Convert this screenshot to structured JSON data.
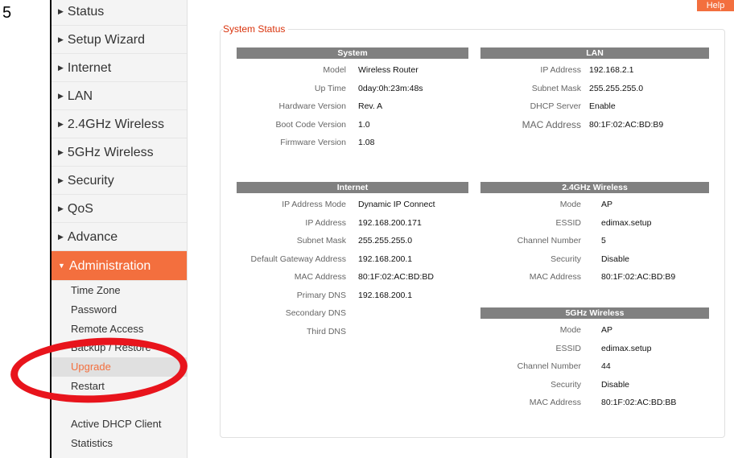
{
  "step_number": "5",
  "help_label": "Help",
  "sidebar": {
    "items": [
      {
        "label": "Status"
      },
      {
        "label": "Setup Wizard"
      },
      {
        "label": "Internet"
      },
      {
        "label": "LAN"
      },
      {
        "label": "2.4GHz Wireless"
      },
      {
        "label": "5GHz Wireless"
      },
      {
        "label": "Security"
      },
      {
        "label": "QoS"
      },
      {
        "label": "Advance"
      },
      {
        "label": "Administration"
      }
    ],
    "admin_subitems": [
      {
        "label": "Time Zone"
      },
      {
        "label": "Password"
      },
      {
        "label": "Remote Access"
      },
      {
        "label": "Backup / Restore"
      },
      {
        "label": "Upgrade"
      },
      {
        "label": "Restart"
      },
      {
        "label": "Active DHCP Client"
      },
      {
        "label": "Statistics"
      }
    ]
  },
  "panel_title": "System Status",
  "system": {
    "header": "System",
    "rows": [
      {
        "label": "Model",
        "value": "Wireless Router"
      },
      {
        "label": "Up Time",
        "value": "0day:0h:23m:48s"
      },
      {
        "label": "Hardware Version",
        "value": "Rev. A"
      },
      {
        "label": "Boot Code Version",
        "value": "1.0"
      },
      {
        "label": "Firmware Version",
        "value": "1.08"
      }
    ]
  },
  "lan": {
    "header": "LAN",
    "rows": [
      {
        "label": "IP Address",
        "value": "192.168.2.1"
      },
      {
        "label": "Subnet Mask",
        "value": "255.255.255.0"
      },
      {
        "label": "DHCP Server",
        "value": "Enable"
      },
      {
        "label": "MAC Address",
        "value": "80:1F:02:AC:BD:B9"
      }
    ]
  },
  "internet": {
    "header": "Internet",
    "rows": [
      {
        "label": "IP Address Mode",
        "value": "Dynamic IP  Connect"
      },
      {
        "label": "IP Address",
        "value": "192.168.200.171"
      },
      {
        "label": "Subnet Mask",
        "value": "255.255.255.0"
      },
      {
        "label": "Default Gateway Address",
        "value": "192.168.200.1"
      },
      {
        "label": "MAC Address",
        "value": "80:1F:02:AC:BD:BD"
      },
      {
        "label": "Primary DNS",
        "value": "192.168.200.1"
      },
      {
        "label": "Secondary DNS",
        "value": ""
      },
      {
        "label": "Third DNS",
        "value": ""
      }
    ]
  },
  "wireless24": {
    "header": "2.4GHz  Wireless",
    "rows": [
      {
        "label": "Mode",
        "value": "AP"
      },
      {
        "label": "ESSID",
        "value": "edimax.setup"
      },
      {
        "label": "Channel Number",
        "value": "5"
      },
      {
        "label": "Security",
        "value": "Disable"
      },
      {
        "label": "MAC Address",
        "value": "80:1F:02:AC:BD:B9"
      }
    ]
  },
  "wireless5": {
    "header": "5GHz  Wireless",
    "rows": [
      {
        "label": "Mode",
        "value": "AP"
      },
      {
        "label": "ESSID",
        "value": "edimax.setup"
      },
      {
        "label": "Channel Number",
        "value": "44"
      },
      {
        "label": "Security",
        "value": "Disable"
      },
      {
        "label": "MAC Address",
        "value": "80:1F:02:AC:BD:BB"
      }
    ]
  },
  "colors": {
    "accent": "#f36f3e",
    "highlight_circle": "#e8141c",
    "section_header": "#808080",
    "panel_title": "#d9330c"
  }
}
